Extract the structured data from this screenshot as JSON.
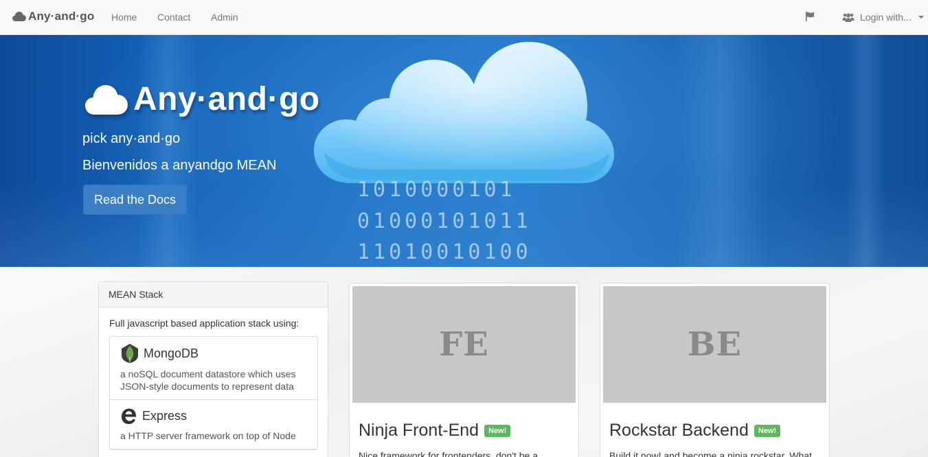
{
  "navbar": {
    "brand": "Any·and·go",
    "links": [
      "Home",
      "Contact",
      "Admin"
    ],
    "flag_icon": "flag-icon",
    "login_label": "Login with...",
    "users_icon": "users-icon"
  },
  "hero": {
    "title": "Any·and·go",
    "tagline": "pick any·and·go",
    "subtitle": "Bienvenidos a anyandgo MEAN",
    "docs_button": "Read the Docs",
    "binary_lines": [
      "1010000101",
      "01000101011",
      "11010010100"
    ]
  },
  "stack_panel": {
    "heading": "MEAN Stack",
    "intro": "Full javascript based application stack using:",
    "items": [
      {
        "name": "MongoDB",
        "icon": "mongodb-leaf-icon",
        "desc_1": "a noSQL document datastore which uses",
        "desc_2": "JSON-style documents to represent data"
      },
      {
        "name": "Express",
        "icon": "express-e-icon",
        "desc_1": "a HTTP server framework on top of Node",
        "desc_2": ""
      }
    ]
  },
  "cards": [
    {
      "thumb": "FE",
      "title": "Ninja Front-End",
      "badge": "New!",
      "text": "Nice framework for frontenders, don't be a"
    },
    {
      "thumb": "BE",
      "title": "Rockstar Backend",
      "badge": "New!",
      "text": "Build it now! and become a ninja rockstar. What"
    }
  ],
  "colors": {
    "hero_blue": "#1a6fc2",
    "badge_green": "#5cb85c",
    "thumb_gray": "#c8c8c8"
  }
}
